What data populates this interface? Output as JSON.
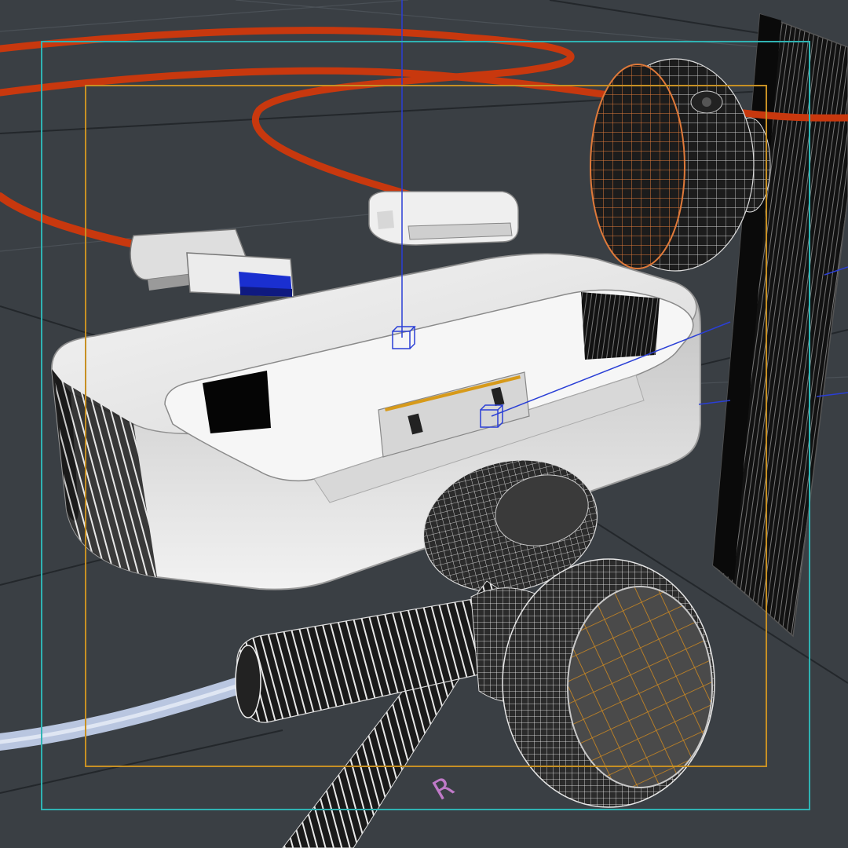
{
  "viewport": {
    "background": "#3a3f44",
    "grid_color": "#23272b",
    "grid_color_light": "#4b5157",
    "safe_frame_outer_color": "#2fb3b3",
    "safe_frame_inner_color": "#c79024",
    "gizmo_color": "#2a3fd6"
  },
  "objects": {
    "usb_cable": {
      "color": "#c8380e"
    },
    "dock_connector": {
      "color": "#e9e9e9"
    },
    "usb_plug": {
      "color": "#e6e6e6",
      "port_color": "#1a2fd0"
    },
    "dock_base": {
      "color": "#ececec",
      "connector_color": "#d6d6d6",
      "accent": "#d79a1a"
    },
    "earbud_right": {
      "color": "#f2f2f2",
      "mesh_color": "#d08a20"
    },
    "earbud_left": {
      "color": "#f2f2f2"
    },
    "earbud_cable": {
      "color": "#b9c6e0"
    },
    "monitor_panel": {
      "color": "#111111"
    },
    "webcam": {
      "color": "#1c1c1c",
      "rim_color": "#e07a3a"
    }
  },
  "earbud_label": "R"
}
